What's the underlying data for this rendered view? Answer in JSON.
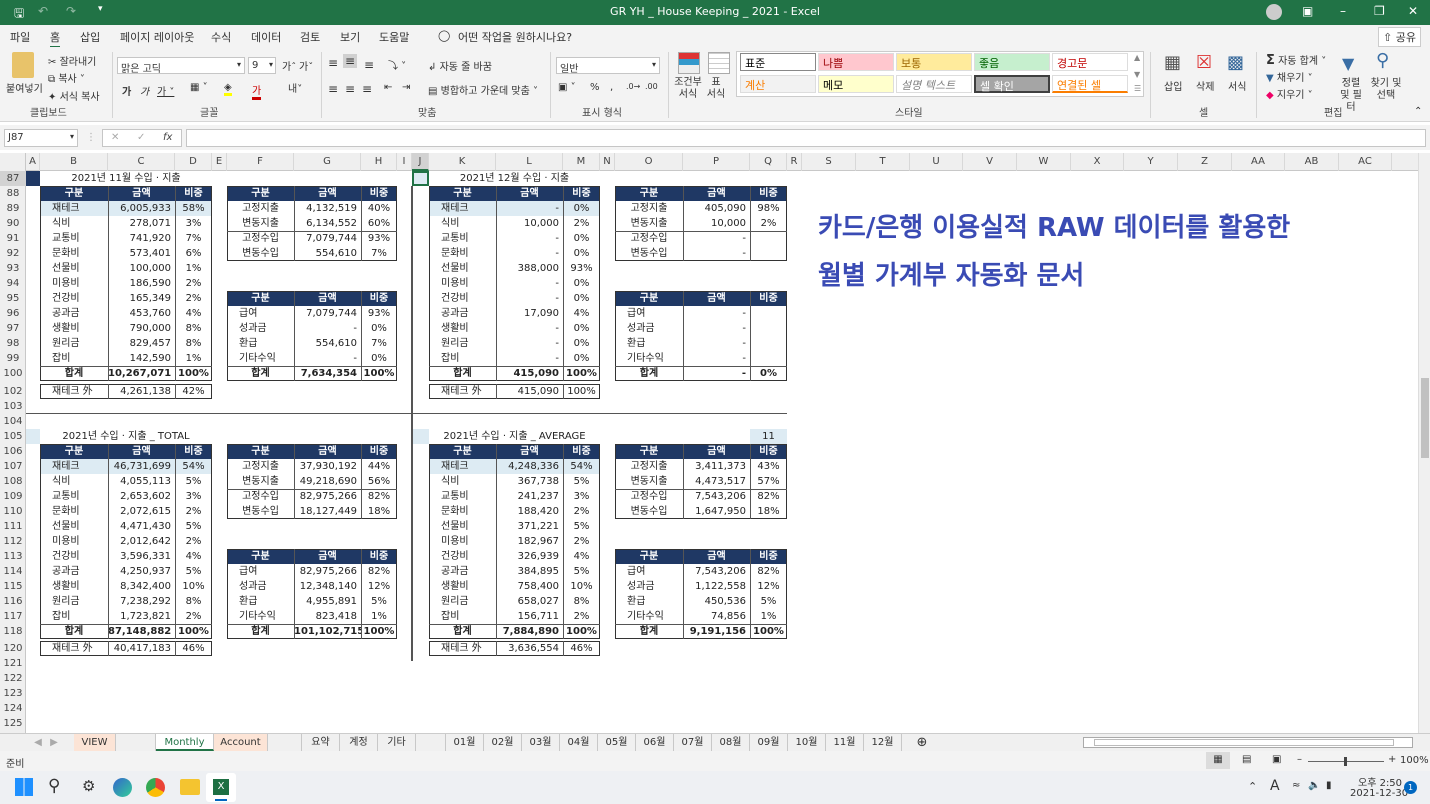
{
  "window": {
    "title": "GR YH _ House Keeping _ 2021  -  Excel"
  },
  "menu": [
    "파일",
    "홈",
    "삽입",
    "페이지 레이아웃",
    "수식",
    "데이터",
    "검토",
    "보기",
    "도움말"
  ],
  "menu_active": "홈",
  "tell_me": "어떤 작업을 원하시나요?",
  "share_label": "공유",
  "ribbon": {
    "clipboard": {
      "paste": "붙여넣기",
      "cut": "잘라내기",
      "copy": "복사",
      "format_painter": "서식 복사",
      "group": "클립보드"
    },
    "font": {
      "name": "맑은 고딕",
      "size": "9",
      "group": "글꼴"
    },
    "align": {
      "wrap": "자동 줄 바꿈",
      "merge": "병합하고 가운데 맞춤",
      "group": "맞춤"
    },
    "number": {
      "format": "일반",
      "group": "표시 형식"
    },
    "styles": {
      "cond_format": "조건부 서식",
      "table_format": "표 서식",
      "group": "스타일",
      "items": [
        {
          "label": "표준",
          "bg": "#ffffff",
          "fg": "#000000"
        },
        {
          "label": "나쁨",
          "bg": "#ffc7ce",
          "fg": "#9c0006"
        },
        {
          "label": "보통",
          "bg": "#ffeb9c",
          "fg": "#9c6500"
        },
        {
          "label": "좋음",
          "bg": "#c6efce",
          "fg": "#006100"
        },
        {
          "label": "경고문",
          "bg": "#ffffff",
          "fg": "#c00000"
        },
        {
          "label": "계산",
          "bg": "#f2f2f2",
          "fg": "#fa7d00"
        },
        {
          "label": "메모",
          "bg": "#ffffcc",
          "fg": "#000000"
        },
        {
          "label": "설명 텍스트",
          "bg": "#ffffff",
          "fg": "#7f7f7f"
        },
        {
          "label": "셀 확인",
          "bg": "#a5a5a5",
          "fg": "#ffffff"
        },
        {
          "label": "연결된 셀",
          "bg": "#ffffff",
          "fg": "#fa7d00"
        }
      ]
    },
    "cells": {
      "insert": "삽입",
      "delete": "삭제",
      "format": "서식",
      "group": "셀"
    },
    "editing": {
      "autosum": "자동 합계",
      "fill": "채우기",
      "clear": "지우기",
      "sort": "정렬 및 필터",
      "find": "찾기 및 선택",
      "group": "편집"
    }
  },
  "formula_bar": {
    "name_box": "J87",
    "formula": ""
  },
  "columns": [
    "A",
    "B",
    "C",
    "D",
    "E",
    "F",
    "G",
    "H",
    "I",
    "J",
    "K",
    "L",
    "M",
    "N",
    "O",
    "P",
    "Q",
    "R",
    "S",
    "T",
    "U",
    "V",
    "W",
    "X",
    "Y",
    "Z",
    "AA",
    "AB",
    "AC"
  ],
  "rows": [
    87,
    88,
    89,
    90,
    91,
    92,
    93,
    94,
    95,
    96,
    97,
    98,
    99,
    100,
    102,
    103,
    104,
    105,
    106,
    107,
    108,
    109,
    110,
    111,
    112,
    113,
    114,
    115,
    116,
    117,
    118,
    120,
    121,
    122,
    123,
    124,
    125
  ],
  "headers": {
    "cat": "구분",
    "amt": "금액",
    "pct": "비중"
  },
  "blocks": [
    {
      "title": "2021년 11월 수입 · 지출",
      "expense": [
        [
          "재테크",
          "6,005,933",
          "58%"
        ],
        [
          "식비",
          "278,071",
          "3%"
        ],
        [
          "교통비",
          "741,920",
          "7%"
        ],
        [
          "문화비",
          "573,401",
          "6%"
        ],
        [
          "선물비",
          "100,000",
          "1%"
        ],
        [
          "미용비",
          "186,590",
          "2%"
        ],
        [
          "건강비",
          "165,349",
          "2%"
        ],
        [
          "공과금",
          "453,760",
          "4%"
        ],
        [
          "생활비",
          "790,000",
          "8%"
        ],
        [
          "원리금",
          "829,457",
          "8%"
        ],
        [
          "잡비",
          "142,590",
          "1%"
        ]
      ],
      "expense_total": [
        "합계",
        "10,267,071",
        "100%"
      ],
      "ex_invest": [
        "재테크 外",
        "4,261,138",
        "42%"
      ],
      "fixvar": [
        [
          "고정지출",
          "4,132,519",
          "40%"
        ],
        [
          "변동지출",
          "6,134,552",
          "60%"
        ],
        [
          "고정수입",
          "7,079,744",
          "93%"
        ],
        [
          "변동수입",
          "554,610",
          "7%"
        ]
      ],
      "income": [
        [
          "급여",
          "7,079,744",
          "93%"
        ],
        [
          "성과금",
          "-",
          "0%"
        ],
        [
          "환급",
          "554,610",
          "7%"
        ],
        [
          "기타수익",
          "-",
          "0%"
        ]
      ],
      "income_total": [
        "합계",
        "7,634,354",
        "100%"
      ]
    },
    {
      "title": "2021년 12월 수입 · 지출",
      "expense": [
        [
          "재테크",
          "-",
          "0%"
        ],
        [
          "식비",
          "10,000",
          "2%"
        ],
        [
          "교통비",
          "-",
          "0%"
        ],
        [
          "문화비",
          "-",
          "0%"
        ],
        [
          "선물비",
          "388,000",
          "93%"
        ],
        [
          "미용비",
          "-",
          "0%"
        ],
        [
          "건강비",
          "-",
          "0%"
        ],
        [
          "공과금",
          "17,090",
          "4%"
        ],
        [
          "생활비",
          "-",
          "0%"
        ],
        [
          "원리금",
          "-",
          "0%"
        ],
        [
          "잡비",
          "-",
          "0%"
        ]
      ],
      "expense_total": [
        "합계",
        "415,090",
        "100%"
      ],
      "ex_invest": [
        "재테크 外",
        "415,090",
        "100%"
      ],
      "fixvar": [
        [
          "고정지출",
          "405,090",
          "98%"
        ],
        [
          "변동지출",
          "10,000",
          "2%"
        ],
        [
          "고정수입",
          "-",
          ""
        ],
        [
          "변동수입",
          "-",
          ""
        ]
      ],
      "income": [
        [
          "급여",
          "-",
          ""
        ],
        [
          "성과금",
          "-",
          ""
        ],
        [
          "환급",
          "-",
          ""
        ],
        [
          "기타수익",
          "-",
          ""
        ]
      ],
      "income_total": [
        "합계",
        "-",
        "0%"
      ]
    },
    {
      "title": "2021년 수입 · 지출 _ TOTAL",
      "expense": [
        [
          "재테크",
          "46,731,699",
          "54%"
        ],
        [
          "식비",
          "4,055,113",
          "5%"
        ],
        [
          "교통비",
          "2,653,602",
          "3%"
        ],
        [
          "문화비",
          "2,072,615",
          "2%"
        ],
        [
          "선물비",
          "4,471,430",
          "5%"
        ],
        [
          "미용비",
          "2,012,642",
          "2%"
        ],
        [
          "건강비",
          "3,596,331",
          "4%"
        ],
        [
          "공과금",
          "4,250,937",
          "5%"
        ],
        [
          "생활비",
          "8,342,400",
          "10%"
        ],
        [
          "원리금",
          "7,238,292",
          "8%"
        ],
        [
          "잡비",
          "1,723,821",
          "2%"
        ]
      ],
      "expense_total": [
        "합계",
        "87,148,882",
        "100%"
      ],
      "ex_invest": [
        "재테크 外",
        "40,417,183",
        "46%"
      ],
      "fixvar": [
        [
          "고정지출",
          "37,930,192",
          "44%"
        ],
        [
          "변동지출",
          "49,218,690",
          "56%"
        ],
        [
          "고정수입",
          "82,975,266",
          "82%"
        ],
        [
          "변동수입",
          "18,127,449",
          "18%"
        ]
      ],
      "income": [
        [
          "급여",
          "82,975,266",
          "82%"
        ],
        [
          "성과금",
          "12,348,140",
          "12%"
        ],
        [
          "환급",
          "4,955,891",
          "5%"
        ],
        [
          "기타수익",
          "823,418",
          "1%"
        ]
      ],
      "income_total": [
        "합계",
        "101,102,715",
        "100%"
      ]
    },
    {
      "title": "2021년 수입 · 지출 _ AVERAGE",
      "month_count": "11",
      "expense": [
        [
          "재테크",
          "4,248,336",
          "54%"
        ],
        [
          "식비",
          "367,738",
          "5%"
        ],
        [
          "교통비",
          "241,237",
          "3%"
        ],
        [
          "문화비",
          "188,420",
          "2%"
        ],
        [
          "선물비",
          "371,221",
          "5%"
        ],
        [
          "미용비",
          "182,967",
          "2%"
        ],
        [
          "건강비",
          "326,939",
          "4%"
        ],
        [
          "공과금",
          "384,895",
          "5%"
        ],
        [
          "생활비",
          "758,400",
          "10%"
        ],
        [
          "원리금",
          "658,027",
          "8%"
        ],
        [
          "잡비",
          "156,711",
          "2%"
        ]
      ],
      "expense_total": [
        "합계",
        "7,884,890",
        "100%"
      ],
      "ex_invest": [
        "재테크 外",
        "3,636,554",
        "46%"
      ],
      "fixvar": [
        [
          "고정지출",
          "3,411,373",
          "43%"
        ],
        [
          "변동지출",
          "4,473,517",
          "57%"
        ],
        [
          "고정수입",
          "7,543,206",
          "82%"
        ],
        [
          "변동수입",
          "1,647,950",
          "18%"
        ]
      ],
      "income": [
        [
          "급여",
          "7,543,206",
          "82%"
        ],
        [
          "성과금",
          "1,122,558",
          "12%"
        ],
        [
          "환급",
          "450,536",
          "5%"
        ],
        [
          "기타수익",
          "74,856",
          "1%"
        ]
      ],
      "income_total": [
        "합계",
        "9,191,156",
        "100%"
      ]
    }
  ],
  "banner": {
    "line1": "카드/은행 이용실적 RAW 데이터를 활용한",
    "line2": "월별 가계부 자동화 문서",
    "color": "#3a4bb4"
  },
  "sheet_tabs": [
    {
      "label": "VIEW",
      "style": "peach"
    },
    {
      "label": "",
      "style": "blank"
    },
    {
      "label": "Monthly",
      "style": "active"
    },
    {
      "label": "Account",
      "style": "peach"
    },
    {
      "label": "",
      "style": "blank"
    },
    {
      "label": "요약",
      "style": "plain"
    },
    {
      "label": "계정",
      "style": "plain"
    },
    {
      "label": "기타",
      "style": "plain"
    },
    {
      "label": "",
      "style": "blank"
    },
    {
      "label": "01월",
      "style": "plain"
    },
    {
      "label": "02월",
      "style": "plain"
    },
    {
      "label": "03월",
      "style": "plain"
    },
    {
      "label": "04월",
      "style": "plain"
    },
    {
      "label": "05월",
      "style": "plain"
    },
    {
      "label": "06월",
      "style": "plain"
    },
    {
      "label": "07월",
      "style": "plain"
    },
    {
      "label": "08월",
      "style": "plain"
    },
    {
      "label": "09월",
      "style": "plain"
    },
    {
      "label": "10월",
      "style": "plain"
    },
    {
      "label": "11월",
      "style": "plain"
    },
    {
      "label": "12월",
      "style": "plain"
    }
  ],
  "status": {
    "ready": "준비",
    "zoom": "100%"
  },
  "taskbar": {
    "time": "오후 2:50",
    "date": "2021-12-30",
    "notifications": "1"
  },
  "colors": {
    "excel_green": "#217346",
    "header_navy": "#1f3864",
    "highlight": "#ddebf3"
  }
}
